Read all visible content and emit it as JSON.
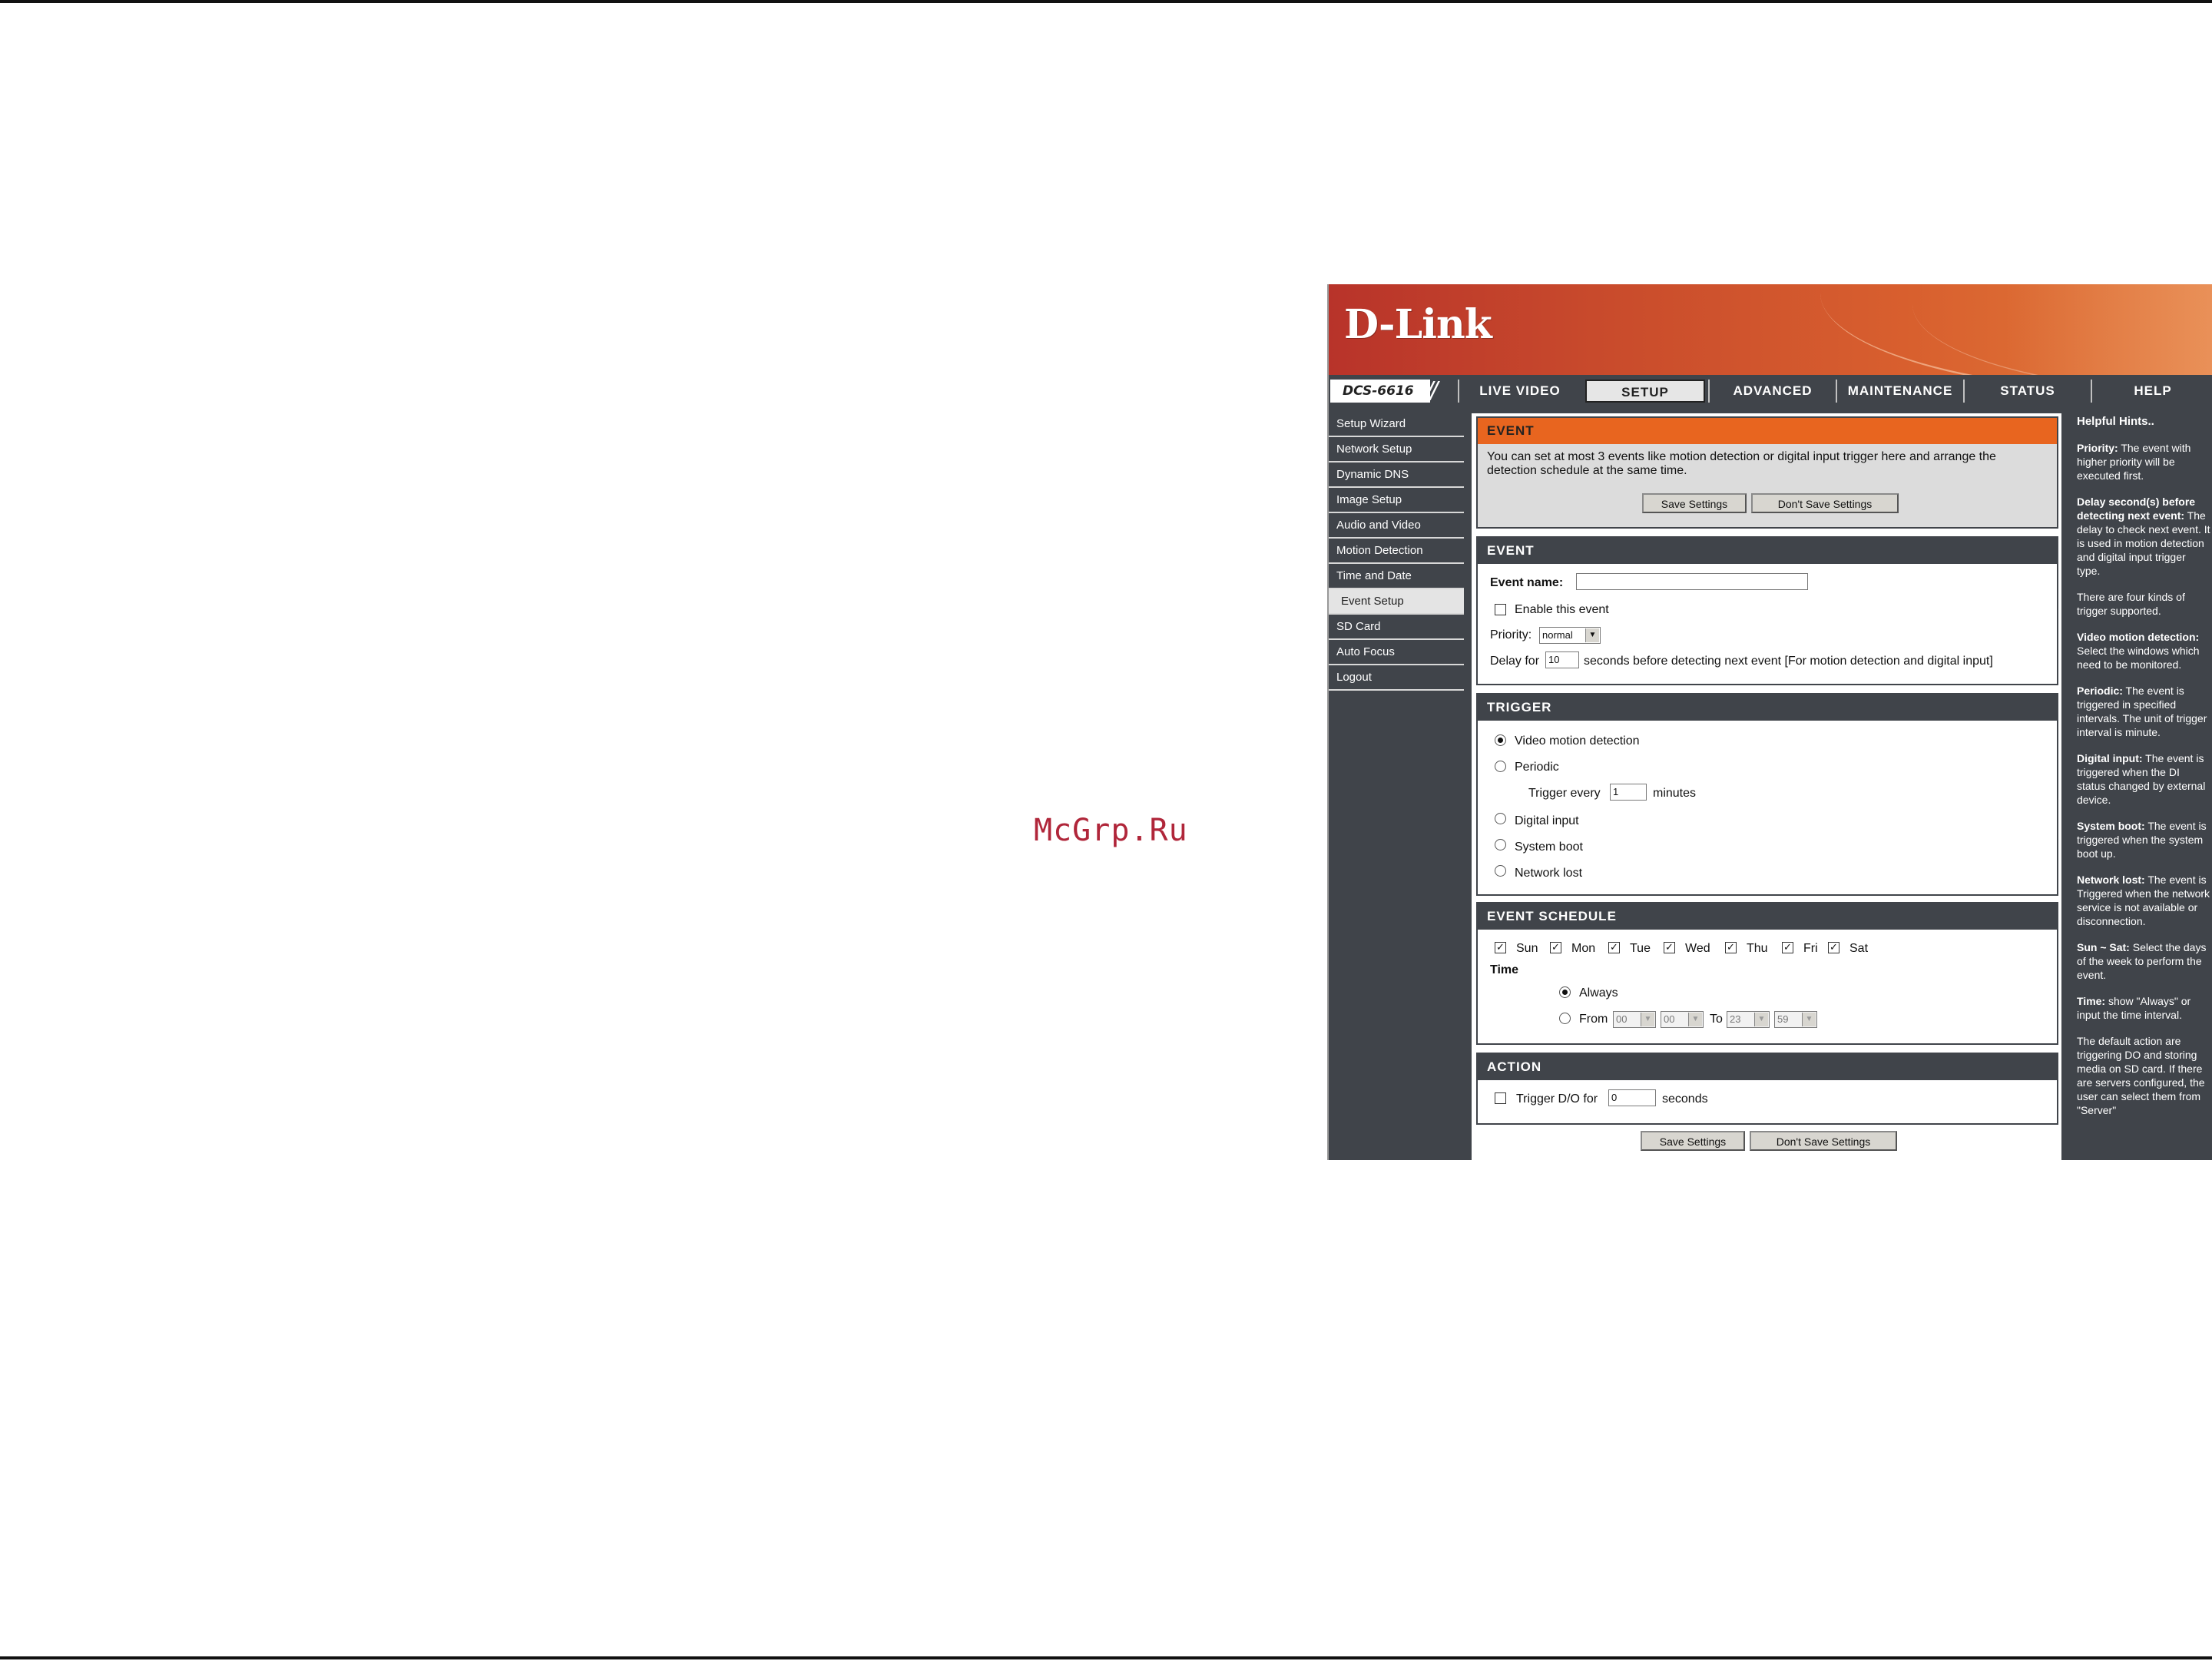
{
  "watermark": "McGrp.Ru",
  "brand": {
    "logo": "D-Link",
    "model": "DCS-6616"
  },
  "nav": {
    "tabs": [
      "LIVE VIDEO",
      "SETUP",
      "ADVANCED",
      "MAINTENANCE",
      "STATUS",
      "HELP"
    ],
    "active": "SETUP"
  },
  "sidebar": {
    "items": [
      "Setup Wizard",
      "Network Setup",
      "Dynamic DNS",
      "Image Setup",
      "Audio and Video",
      "Motion Detection",
      "Time and Date",
      "Event Setup",
      "SD Card",
      "Auto Focus",
      "Logout"
    ],
    "active": "Event Setup"
  },
  "intro": {
    "title": "EVENT",
    "text_line1": "You can set at most 3 events like motion detection or digital input trigger here and arrange the",
    "text_line2": "detection schedule at the same time.",
    "save": "Save Settings",
    "dont_save": "Don't Save Settings"
  },
  "event": {
    "title": "EVENT",
    "name_label": "Event name:",
    "name_value": "",
    "enable_label": "Enable this event",
    "enable_checked": false,
    "priority_label": "Priority:",
    "priority_value": "normal",
    "delay_label": "Delay for",
    "delay_value": "10",
    "delay_suffix": "seconds before detecting next event [For motion detection and digital input]"
  },
  "trigger": {
    "title": "TRIGGER",
    "options": [
      "Video motion detection",
      "Periodic",
      "Digital input",
      "System boot",
      "Network lost"
    ],
    "selected": "Video motion detection",
    "every_label": "Trigger every",
    "every_value": "1",
    "every_unit": "minutes"
  },
  "schedule": {
    "title": "EVENT SCHEDULE",
    "days": [
      "Sun",
      "Mon",
      "Tue",
      "Wed",
      "Thu",
      "Fri",
      "Sat"
    ],
    "days_checked": [
      true,
      true,
      true,
      true,
      true,
      true,
      true
    ],
    "time_label": "Time",
    "always_label": "Always",
    "from_label": "From",
    "to_label": "To",
    "from_h": "00",
    "from_m": "00",
    "to_h": "23",
    "to_m": "59"
  },
  "action": {
    "title": "ACTION",
    "trigger_label": "Trigger D/O for",
    "trigger_value": "0",
    "trigger_unit": "seconds"
  },
  "bottom": {
    "save": "Save Settings",
    "dont_save": "Don't Save Settings"
  },
  "help": {
    "title": "Helpful Hints..",
    "hints": [
      {
        "term": "Priority:",
        "text": " The event with higher priority will be executed first."
      },
      {
        "term": "Delay second(s) before detecting next event:",
        "text": " The delay to check next event. It is used in motion detection and digital input trigger type."
      },
      {
        "term": "",
        "text": "There are four kinds of trigger supported."
      },
      {
        "term": "Video motion detection:",
        "text": " Select the windows which need to be monitored."
      },
      {
        "term": "Periodic:",
        "text": " The event is triggered in specified intervals. The unit of trigger interval is minute."
      },
      {
        "term": "Digital input:",
        "text": " The event is triggered when the DI status changed by external device."
      },
      {
        "term": "System boot:",
        "text": " The event is triggered when the system boot up."
      },
      {
        "term": "Network lost:",
        "text": " The event is Triggered when the network service is not available or disconnection."
      },
      {
        "term": "Sun ~ Sat:",
        "text": " Select the days of the week to perform the event."
      },
      {
        "term": "Time:",
        "text": " show \"Always\" or input the time interval."
      },
      {
        "term": "",
        "text": "The default action are triggering DO and storing media on SD card. If there are servers configured, the user can select them from \"Server\""
      }
    ]
  },
  "colors": {
    "accent_orange": "#e8651f",
    "dark_panel": "#40444a",
    "banner_red": "#b8332a"
  }
}
